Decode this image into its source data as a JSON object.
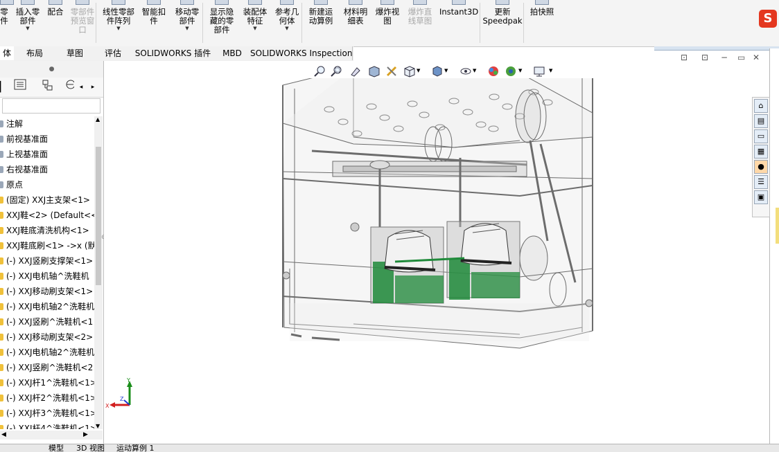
{
  "ribbon": {
    "buttons": [
      {
        "id": "partial-left",
        "label": "零\n件",
        "disabled": false
      },
      {
        "id": "insert-part",
        "label": "插入零\n部件",
        "disabled": false,
        "dropdown": true
      },
      {
        "id": "mate",
        "label": "配合",
        "disabled": false
      },
      {
        "id": "part-preview",
        "label": "零部件\n预览窗\n口",
        "disabled": true
      },
      {
        "id": "linear-pattern",
        "label": "线性零部\n件阵列",
        "disabled": false,
        "dropdown": true
      },
      {
        "id": "smart-fastener",
        "label": "智能扣\n件",
        "disabled": false
      },
      {
        "id": "move-component",
        "label": "移动零\n部件",
        "disabled": false,
        "dropdown": true
      },
      {
        "id": "show-hidden",
        "label": "显示隐\n藏的零\n部件",
        "disabled": false
      },
      {
        "id": "assembly-feature",
        "label": "装配体\n特征",
        "disabled": false,
        "dropdown": true
      },
      {
        "id": "ref-geometry",
        "label": "参考几\n何体",
        "disabled": false,
        "dropdown": true
      },
      {
        "id": "new-motion-study",
        "label": "新建运\n动算例",
        "disabled": false
      },
      {
        "id": "bom",
        "label": "材料明\n细表",
        "disabled": false
      },
      {
        "id": "exploded-view",
        "label": "爆炸视\n图",
        "disabled": false
      },
      {
        "id": "explode-line-sketch",
        "label": "爆炸直\n线草图",
        "disabled": true
      },
      {
        "id": "instant3d",
        "label": "Instant3D",
        "disabled": false
      },
      {
        "id": "update-speedpak",
        "label": "更新\nSpeedpak",
        "disabled": false
      },
      {
        "id": "snapshot",
        "label": "拍快照",
        "disabled": false
      }
    ]
  },
  "tabs": [
    {
      "label": "体",
      "active": true
    },
    {
      "label": "布局"
    },
    {
      "label": "草图"
    },
    {
      "label": "评估"
    },
    {
      "label": "SOLIDWORKS 插件"
    },
    {
      "label": "MBD"
    },
    {
      "label": "SOLIDWORKS Inspection"
    }
  ],
  "tree": [
    "注解",
    "前视基准面",
    "上视基准面",
    "右视基准面",
    "原点",
    "(固定) XXJ主支架<1>",
    "XXJ鞋<2> (Default<<",
    "XXJ鞋底清洗机构<1>",
    "XXJ鞋底刷<1> ->x (默",
    "(-) XXJ竖刷支撑架<1>",
    "(-) XXJ电机轴^洗鞋机",
    "(-) XXJ移动刷支架<1>",
    "(-) XXJ电机轴2^洗鞋机",
    "(-) XXJ竖刷^洗鞋机<1",
    "(-) XXJ移动刷支架<2>",
    "(-) XXJ电机轴2^洗鞋机",
    "(-) XXJ竖刷^洗鞋机<2",
    "(-) XXJ杆1^洗鞋机<1>",
    "(-) XXJ杆2^洗鞋机<1>",
    "(-) XXJ杆3^洗鞋机<1>",
    "(-) XXJ杆4^洗鞋机<1>"
  ],
  "bottom_tabs": [
    "模型",
    "3D 视图",
    "运动算例 1"
  ],
  "triad": {
    "x": "X",
    "y": "Y",
    "z": "Z"
  },
  "logo_text": "S",
  "colors": {
    "accent": "#e4371f",
    "ribbon_bg": "#f4f4f4",
    "brush_green": "#1f8a3a"
  }
}
